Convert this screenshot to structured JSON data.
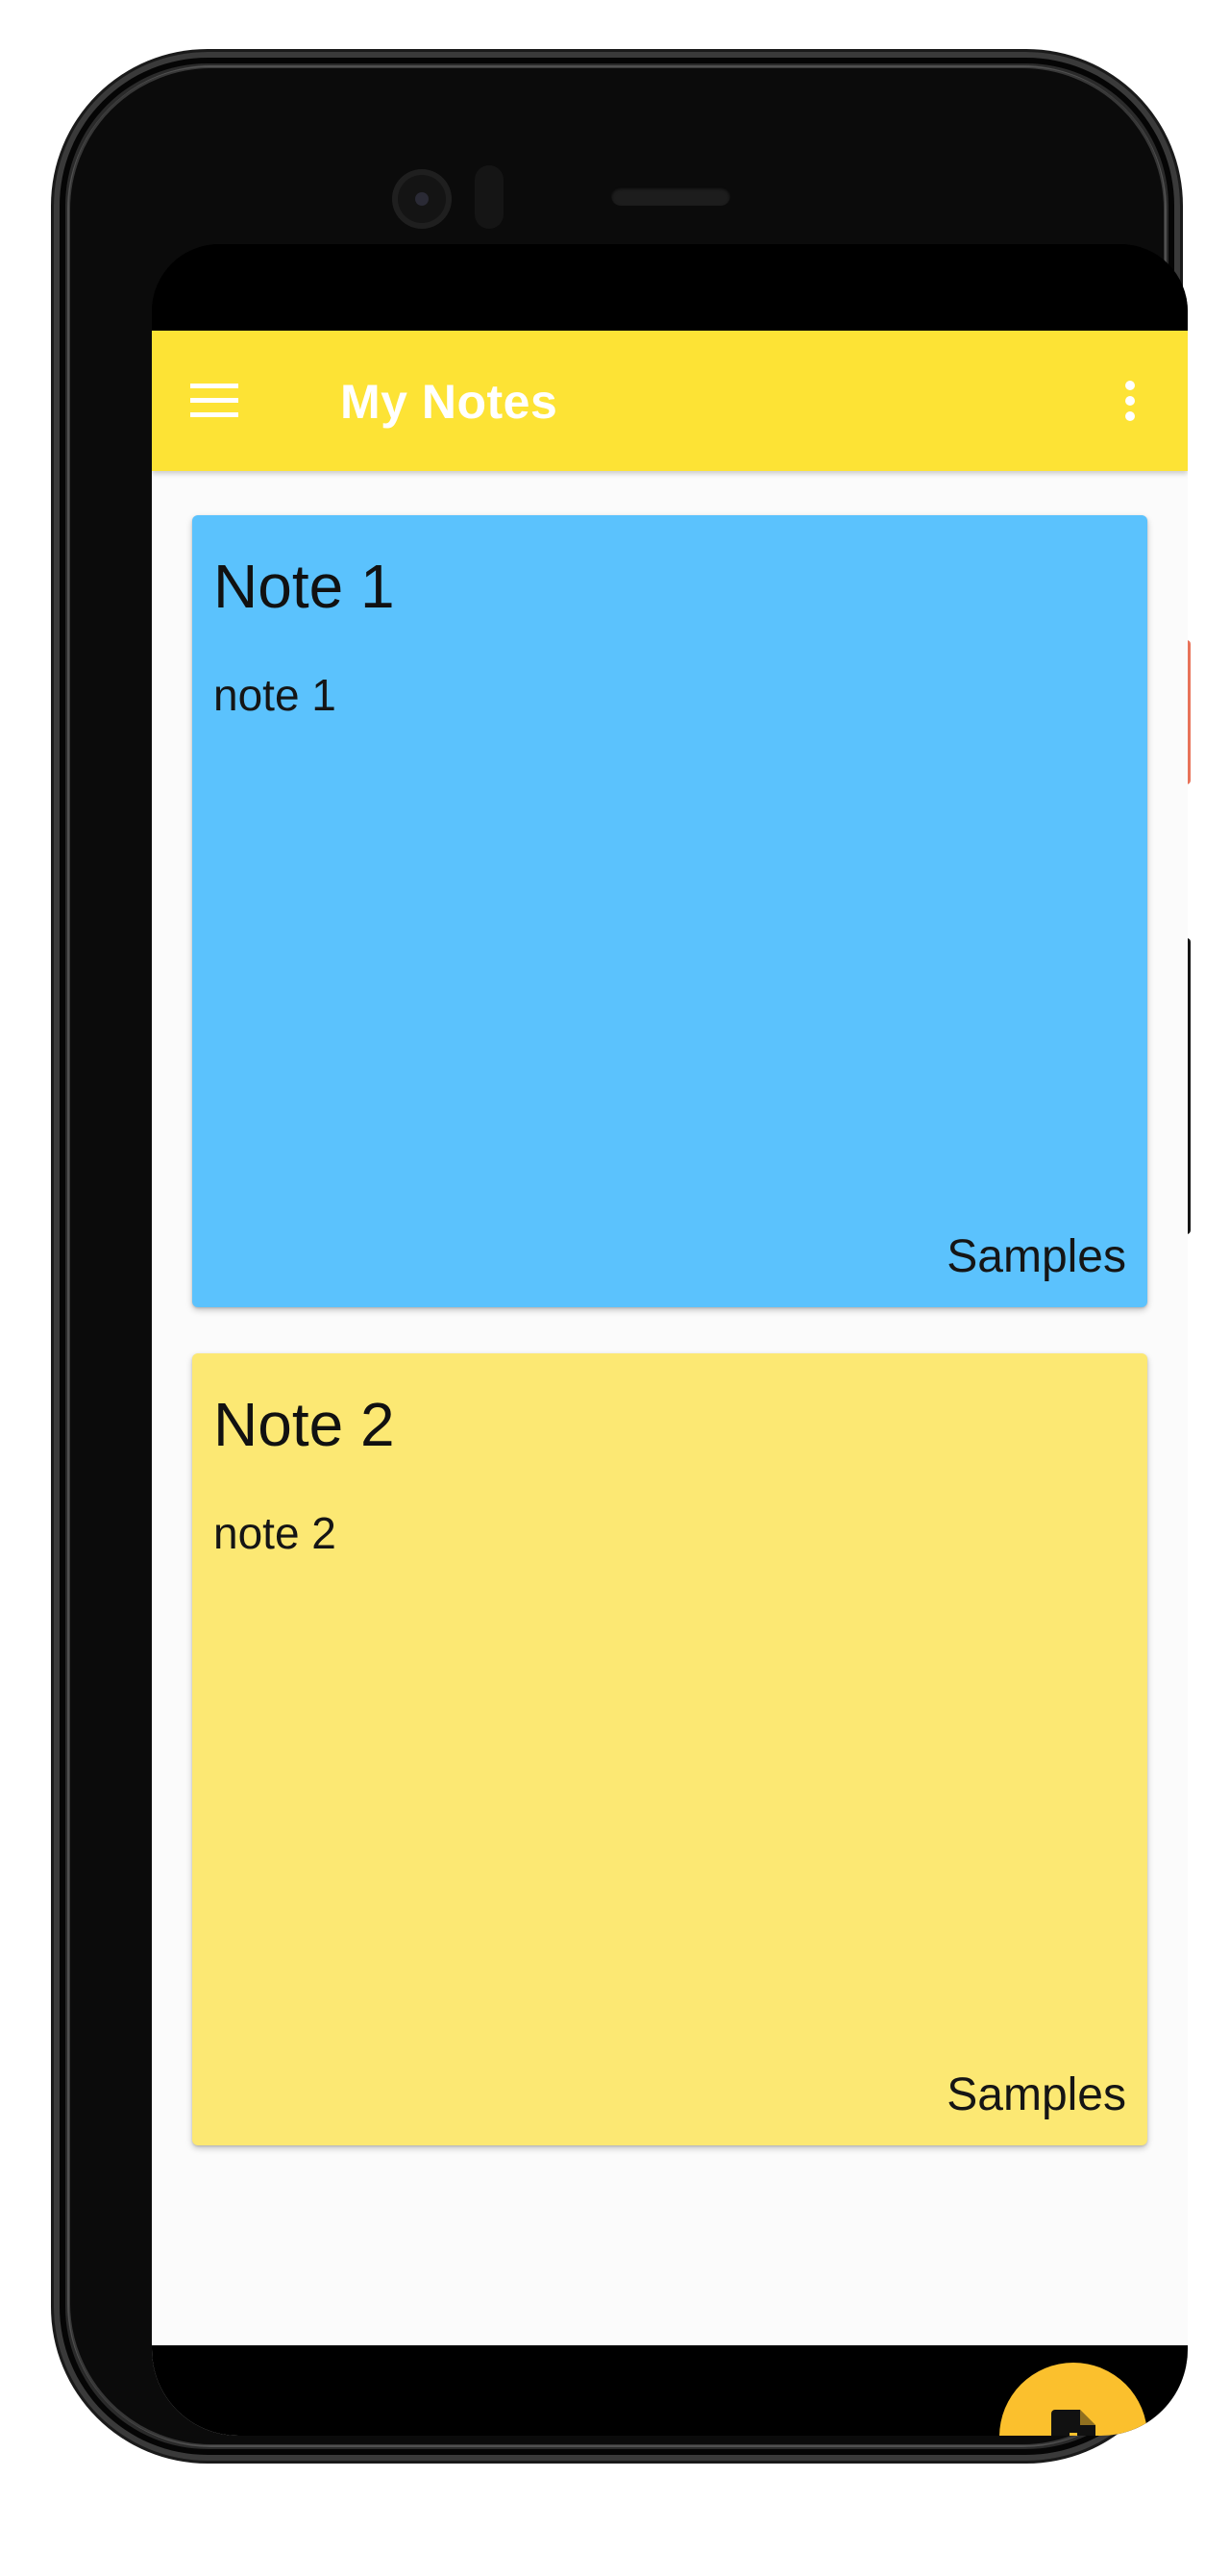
{
  "app_bar": {
    "title": "My Notes",
    "menu_icon": "hamburger-menu-icon",
    "overflow_icon": "more-vert-icon",
    "background_color": "#fde335",
    "title_color": "#ffffff"
  },
  "notes": [
    {
      "title": "Note 1",
      "body": "note 1",
      "tag": "Samples",
      "color": "#5bc2fd"
    },
    {
      "title": "Note 2",
      "body": "note 2",
      "tag": "Samples",
      "color": "#fce873"
    }
  ],
  "fab": {
    "icon": "add-note-icon",
    "color": "#fbc02d"
  }
}
